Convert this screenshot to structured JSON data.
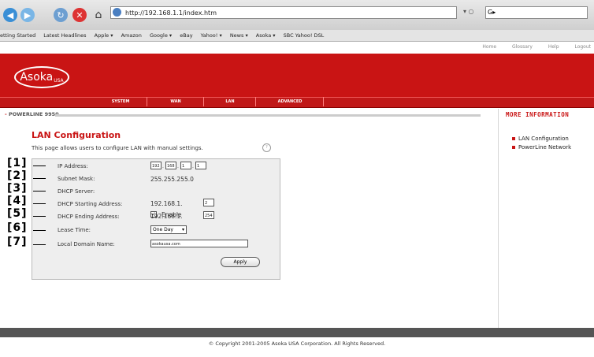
{
  "browser": {
    "url": "http://192.168.1.1/index.htm",
    "bookmarks": [
      "etting Started",
      "Latest Headlines",
      "Apple ▾",
      "Amazon",
      "Google ▾",
      "eBay",
      "Yahoo! ▾",
      "News ▾",
      "Asoka ▾",
      "SBC Yahoo! DSL"
    ]
  },
  "toplinks": [
    "Home",
    "Glossary",
    "Help",
    "Logout"
  ],
  "logo": {
    "text": "Asoka",
    "sub": "USA"
  },
  "menu": [
    "SYSTEM",
    "WAN",
    "LAN",
    "ADVANCED"
  ],
  "breadcrumb": "POWERLINE 9950",
  "sidebar": {
    "title": "MORE INFORMATION",
    "links": [
      "LAN Configuration",
      "PowerLine Network"
    ]
  },
  "content": {
    "title": "LAN Configuration",
    "description": "This page allows users to configure LAN with manual settings.",
    "help": "?"
  },
  "rows": [
    {
      "num": "[1]",
      "label": "IP Address:"
    },
    {
      "num": "[2]",
      "label": "Subnet Mask:"
    },
    {
      "num": "[3]",
      "label": "DHCP Server:"
    },
    {
      "num": "[4]",
      "label": "DHCP Starting Address:"
    },
    {
      "num": "[5]",
      "label": "DHCP Ending Address:"
    },
    {
      "num": "[6]",
      "label": "Lease Time:"
    },
    {
      "num": "[7]",
      "label": "Local Domain Name:"
    }
  ],
  "fields": {
    "ip": [
      "192",
      "168",
      "1",
      "1"
    ],
    "subnet_mask": "255.255.255.0",
    "dhcp_enable_label": "Enable",
    "dhcp_checked": "✓",
    "dhcp_start_prefix": "192.168.1.",
    "dhcp_start_last": "2",
    "dhcp_end_prefix": "192.168.1.",
    "dhcp_end_last": "254",
    "lease_time": "One Day",
    "domain": "asokausa.com"
  },
  "apply_label": "Apply",
  "footer": "© Copyright 2001-2005   Asoka USA Corporation. All Rights Reserved.",
  "colors": {
    "brand_red": "#c91414"
  }
}
